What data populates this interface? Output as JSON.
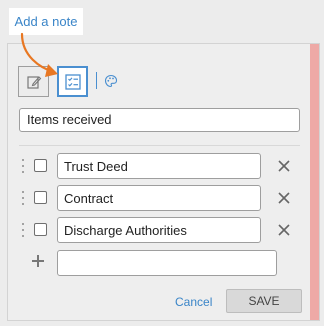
{
  "tab": {
    "label": "Add a note"
  },
  "toolbar": {
    "note_icon": "edit-note-icon",
    "checklist_icon": "checklist-icon",
    "palette_icon": "palette-icon"
  },
  "title_field": {
    "value": "Items received"
  },
  "items": [
    {
      "label": "Trust Deed",
      "checked": false
    },
    {
      "label": "Contract",
      "checked": false
    },
    {
      "label": "Discharge Authorities",
      "checked": false
    }
  ],
  "new_item": {
    "value": ""
  },
  "actions": {
    "cancel_label": "Cancel",
    "save_label": "SAVE"
  },
  "colors": {
    "accent": "#3a85c8",
    "annotation_arrow": "#e87722",
    "side_bar": "#eea9a6"
  }
}
